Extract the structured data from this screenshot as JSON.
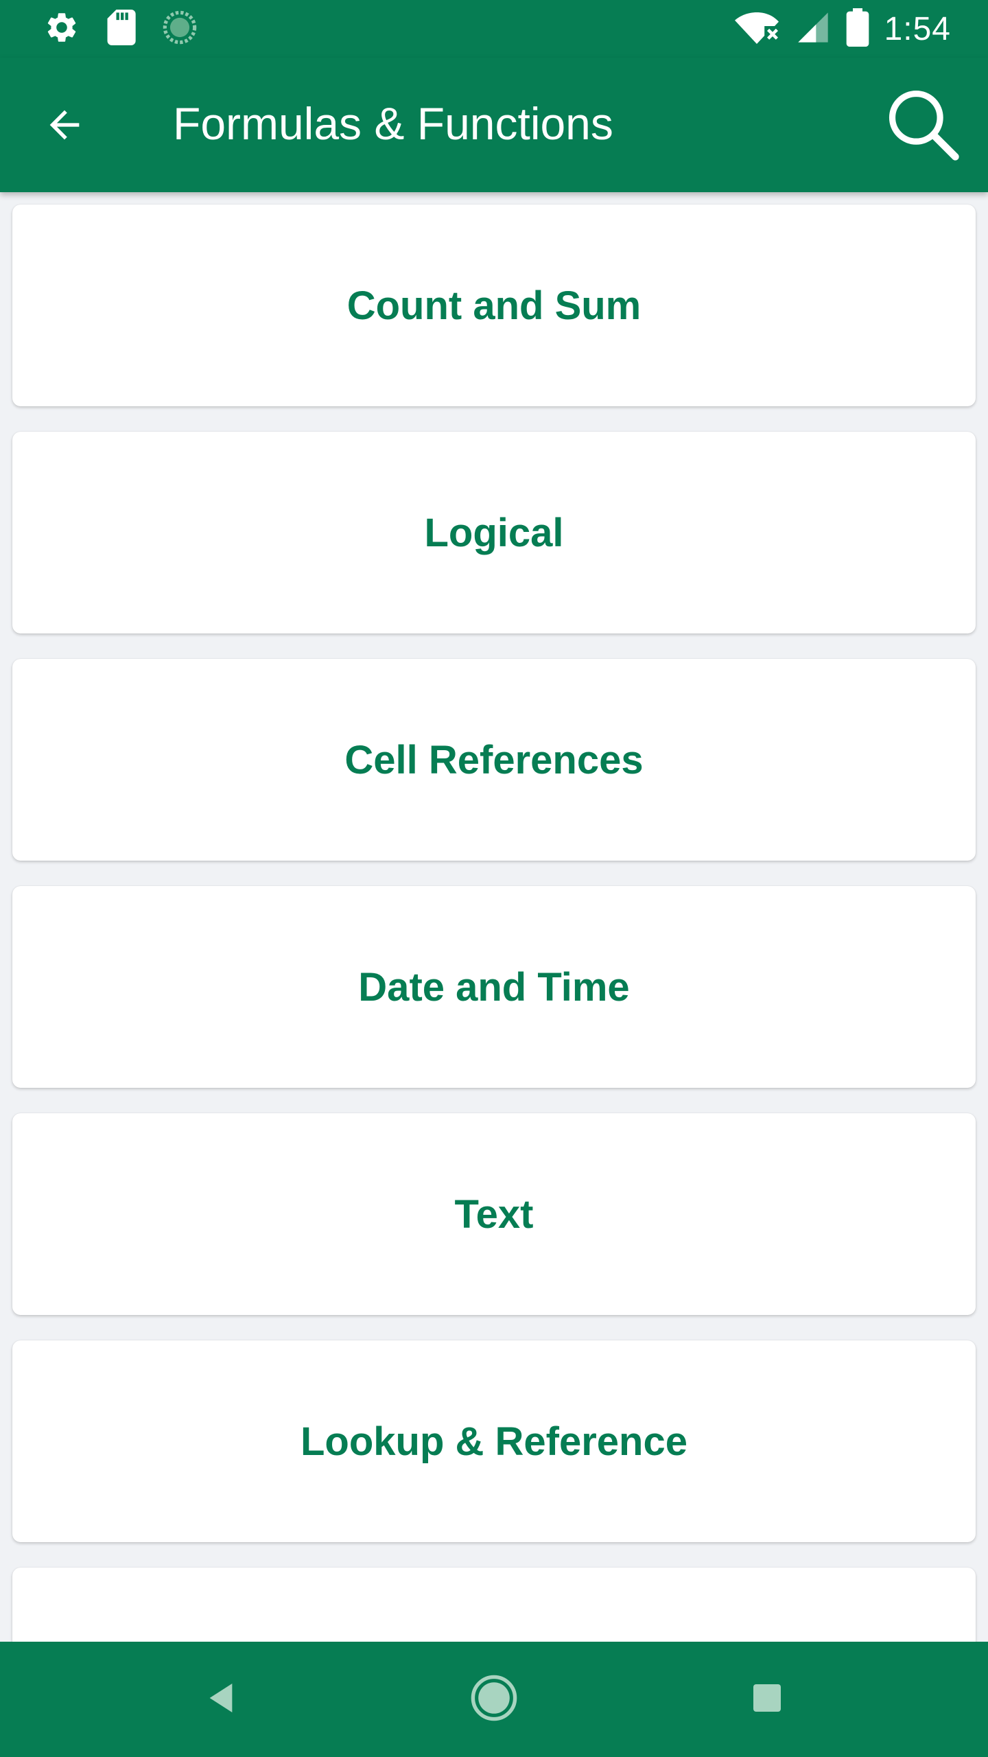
{
  "status_bar": {
    "time": "1:54",
    "icons": [
      "settings-icon",
      "sd-card-icon",
      "sync-icon",
      "wifi-no-internet-icon",
      "signal-icon",
      "battery-icon"
    ]
  },
  "app_bar": {
    "title": "Formulas & Functions",
    "back_icon": "arrow-back-icon",
    "search_icon": "search-icon"
  },
  "categories": [
    {
      "label": "Count and Sum"
    },
    {
      "label": "Logical"
    },
    {
      "label": "Cell References"
    },
    {
      "label": "Date and Time"
    },
    {
      "label": "Text"
    },
    {
      "label": "Lookup & Reference"
    },
    {
      "label": ""
    }
  ],
  "nav_bar": {
    "icons": [
      "nav-back-icon",
      "nav-home-icon",
      "nav-recents-icon"
    ]
  },
  "colors": {
    "primary": "#067d53",
    "background": "#f0f2f5",
    "card": "#ffffff",
    "nav_icon": "#a8d4c0"
  }
}
